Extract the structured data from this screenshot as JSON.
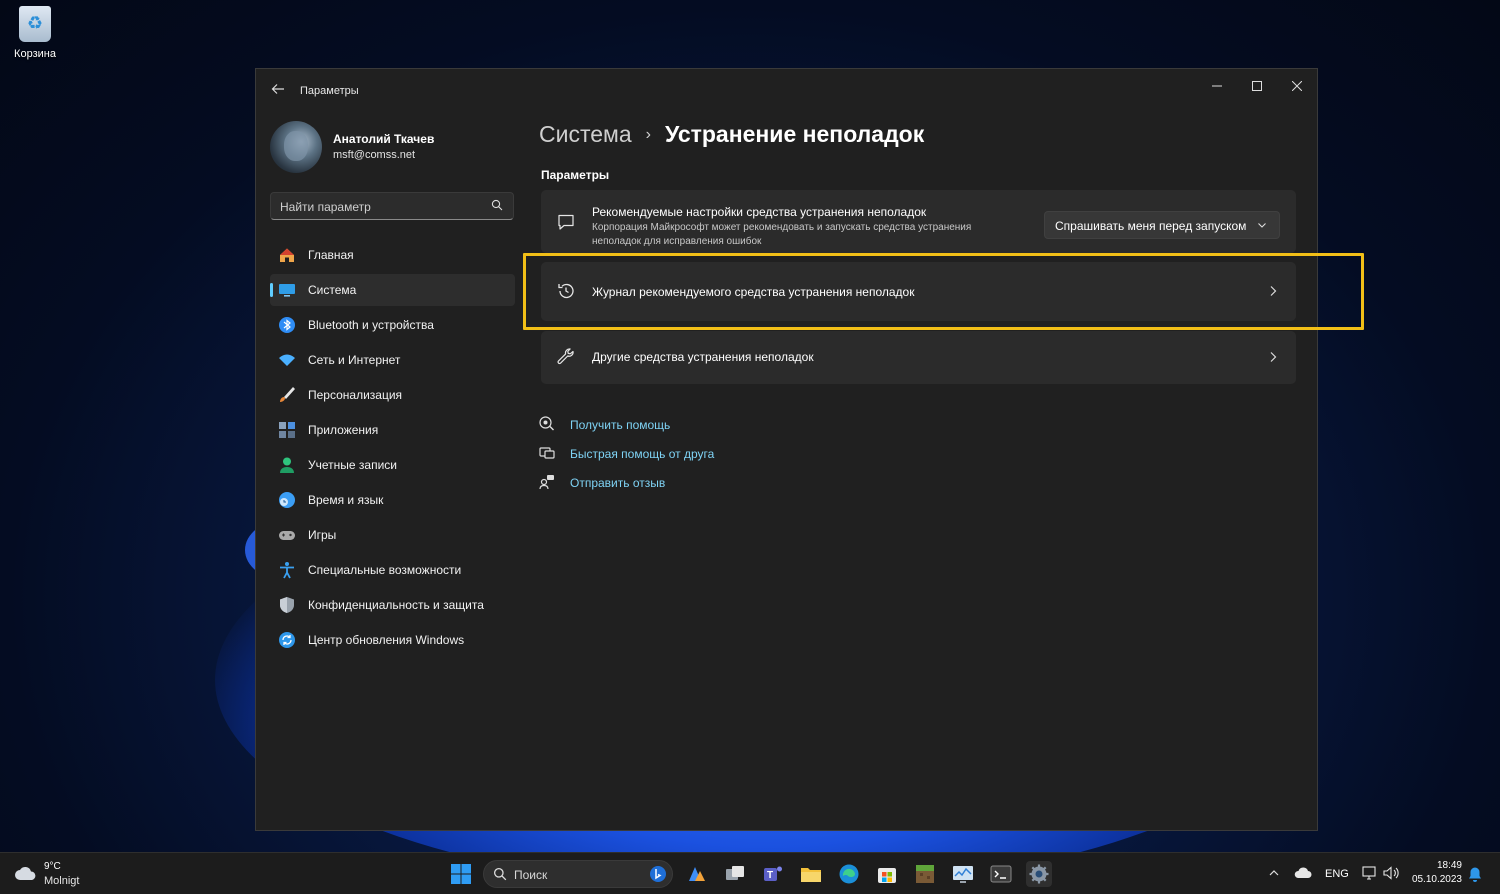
{
  "desktop": {
    "recycle_bin_label": "Корзина"
  },
  "window": {
    "title": "Параметры",
    "controls": {
      "minimize": "—",
      "maximize": "☐",
      "close": "✕"
    }
  },
  "profile": {
    "name": "Анатолий Ткачев",
    "email": "msft@comss.net"
  },
  "search": {
    "placeholder": "Найти параметр"
  },
  "sidebar": {
    "items": [
      {
        "label": "Главная",
        "icon": "home-icon",
        "color": "#f0a64a"
      },
      {
        "label": "Система",
        "icon": "system-icon",
        "color": "#2f9de8",
        "active": true
      },
      {
        "label": "Bluetooth и устройства",
        "icon": "bluetooth-icon",
        "color": "#2f8df5"
      },
      {
        "label": "Сеть и Интернет",
        "icon": "wifi-icon",
        "color": "#4ab0ff"
      },
      {
        "label": "Персонализация",
        "icon": "brush-icon",
        "color": "#e8883a"
      },
      {
        "label": "Приложения",
        "icon": "apps-icon",
        "color": "#8aa2bd"
      },
      {
        "label": "Учетные записи",
        "icon": "accounts-icon",
        "color": "#2fc47d"
      },
      {
        "label": "Время и язык",
        "icon": "globe-clock-icon",
        "color": "#3b9ef5"
      },
      {
        "label": "Игры",
        "icon": "gamepad-icon",
        "color": "#a9a9a9"
      },
      {
        "label": "Специальные возможности",
        "icon": "accessibility-icon",
        "color": "#3aa0f0"
      },
      {
        "label": "Конфиденциальность и защита",
        "icon": "shield-icon",
        "color": "#9aa3ad"
      },
      {
        "label": "Центр обновления Windows",
        "icon": "update-icon",
        "color": "#2e97ea"
      }
    ]
  },
  "breadcrumb": {
    "parent": "Система",
    "separator": "›",
    "current": "Устранение неполадок"
  },
  "section": {
    "title": "Параметры"
  },
  "cards": {
    "recommended": {
      "title": "Рекомендуемые настройки средства устранения неполадок",
      "description": "Корпорация Майкрософт может рекомендовать и запускать средства устранения неполадок для исправления ошибок",
      "dropdown_value": "Спрашивать меня перед запуском"
    },
    "history": {
      "title": "Журнал рекомендуемого средства устранения неполадок"
    },
    "other": {
      "title": "Другие средства устранения неполадок"
    }
  },
  "links": [
    {
      "label": "Получить помощь",
      "icon": "help-icon"
    },
    {
      "label": "Быстрая помощь от друга",
      "icon": "quick-assist-icon"
    },
    {
      "label": "Отправить отзыв",
      "icon": "feedback-icon"
    }
  ],
  "taskbar": {
    "weather_temp": "9°C",
    "weather_desc": "Molnigt",
    "search_label": "Поиск",
    "language": "ENG",
    "time": "18:49",
    "date": "05.10.2023"
  },
  "colors": {
    "accent": "#60cdff",
    "link": "#7fd3f5",
    "highlight": "#f2bf17"
  }
}
